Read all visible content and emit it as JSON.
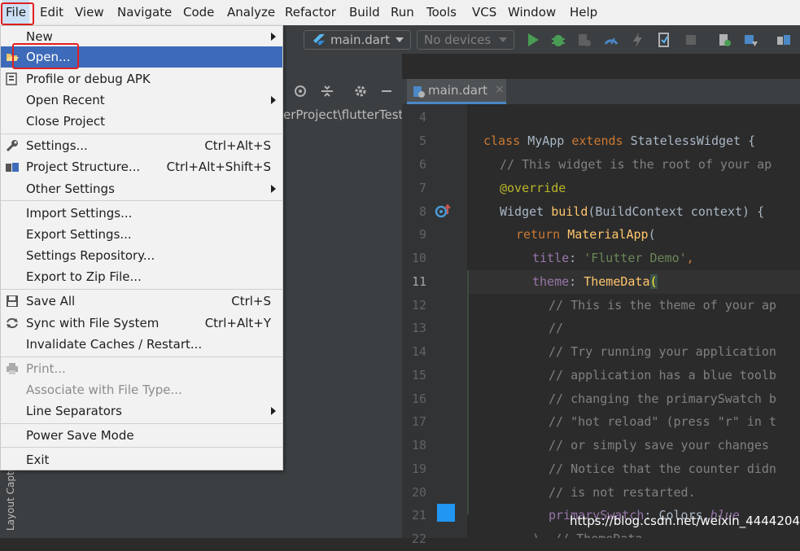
{
  "menubar": {
    "items": [
      "File",
      "Edit",
      "View",
      "Navigate",
      "Code",
      "Analyze",
      "Refactor",
      "Build",
      "Run",
      "Tools",
      "VCS",
      "Window",
      "Help"
    ]
  },
  "toolbar": {
    "run_config": "main.dart",
    "device": "No devices"
  },
  "project_panel": {
    "path": "erProject\\flutterTest",
    "side_label": "Layout Captur"
  },
  "editor": {
    "tab": "main.dart",
    "tab_close": "×",
    "line_numbers": [
      "4",
      "5",
      "6",
      "7",
      "8",
      "9",
      "10",
      "11",
      "12",
      "13",
      "14",
      "15",
      "16",
      "17",
      "18",
      "19",
      "20",
      "21",
      "22"
    ],
    "current_line": "11"
  },
  "file_menu": {
    "items": [
      {
        "label": "New",
        "shortcut": "",
        "submenu": true
      },
      {
        "label": "Open...",
        "shortcut": "",
        "submenu": false
      },
      {
        "label": "Profile or debug APK",
        "shortcut": "",
        "submenu": false
      },
      {
        "label": "Open Recent",
        "shortcut": "",
        "submenu": true
      },
      {
        "label": "Close Project",
        "shortcut": "",
        "submenu": false
      },
      {
        "label": "Settings...",
        "shortcut": "Ctrl+Alt+S",
        "submenu": false
      },
      {
        "label": "Project Structure...",
        "shortcut": "Ctrl+Alt+Shift+S",
        "submenu": false
      },
      {
        "label": "Other Settings",
        "shortcut": "",
        "submenu": true
      },
      {
        "label": "Import Settings...",
        "shortcut": "",
        "submenu": false
      },
      {
        "label": "Export Settings...",
        "shortcut": "",
        "submenu": false
      },
      {
        "label": "Settings Repository...",
        "shortcut": "",
        "submenu": false
      },
      {
        "label": "Export to Zip File...",
        "shortcut": "",
        "submenu": false
      },
      {
        "label": "Save All",
        "shortcut": "Ctrl+S",
        "submenu": false
      },
      {
        "label": "Sync with File System",
        "shortcut": "Ctrl+Alt+Y",
        "submenu": false
      },
      {
        "label": "Invalidate Caches / Restart...",
        "shortcut": "",
        "submenu": false
      },
      {
        "label": "Print...",
        "shortcut": "",
        "submenu": false
      },
      {
        "label": "Associate with File Type...",
        "shortcut": "",
        "submenu": false
      },
      {
        "label": "Line Separators",
        "shortcut": "",
        "submenu": true
      },
      {
        "label": "Power Save Mode",
        "shortcut": "",
        "submenu": false
      },
      {
        "label": "Exit",
        "shortcut": "",
        "submenu": false
      }
    ]
  },
  "code": {
    "l5_kw1": "class ",
    "l5_cls": "MyApp ",
    "l5_kw2": "extends ",
    "l5_rest": "StatelessWidget {",
    "l6": "// This widget is the root of your ap",
    "l7": "@override",
    "l8_a": "Widget ",
    "l8_fn": "build",
    "l8_b": "(BuildContext context) {",
    "l9_kw": "return ",
    "l9_fn": "MaterialApp",
    "l9_b": "(",
    "l10_p": "title",
    "l10_c": ": ",
    "l10_s": "'Flutter Demo'",
    "l10_e": ",",
    "l11_p": "theme",
    "l11_c": ": ",
    "l11_fn": "ThemeData",
    "l11_b": "(",
    "l12": "// This is the theme of your ap",
    "l13": "//",
    "l14": "// Try running your application",
    "l15": "// application has a blue toolb",
    "l16": "// changing the primarySwatch b",
    "l17": "// \"hot reload\" (press \"r\" in t",
    "l18": "// or simply save your changes",
    "l19": "// Notice that the counter didn",
    "l20": "// is not restarted.",
    "l21_p": "primarySwatch",
    "l21_c": ": Colors.",
    "l21_i": "blue",
    "l22": "), // ThemeData"
  },
  "watermark": "https://blog.csdn.net/weixin_44442049",
  "colors": {
    "accent": "#3e6bb9",
    "highlight_box": "#e02020",
    "menu_bg": "#f2f2f2",
    "editor_bg": "#2b2b2b"
  }
}
